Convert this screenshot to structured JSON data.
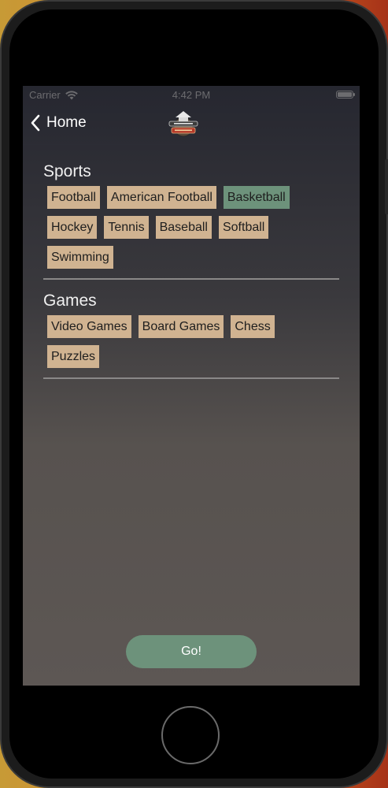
{
  "status_bar": {
    "carrier": "Carrier",
    "time": "4:42 PM",
    "wifi_icon": "wifi-icon",
    "battery_icon": "battery-icon",
    "battery_level": 1.0
  },
  "nav": {
    "back_label": "Home",
    "back_icon": "chevron-left-icon",
    "logo_icon": "village-sports-logo"
  },
  "sections": [
    {
      "title": "Sports",
      "tags": [
        {
          "label": "Football",
          "selected": false
        },
        {
          "label": "American Football",
          "selected": false
        },
        {
          "label": "Basketball",
          "selected": true
        },
        {
          "label": "Hockey",
          "selected": false
        },
        {
          "label": "Tennis",
          "selected": false
        },
        {
          "label": "Baseball",
          "selected": false
        },
        {
          "label": "Softball",
          "selected": false
        },
        {
          "label": "Swimming",
          "selected": false
        }
      ]
    },
    {
      "title": "Games",
      "tags": [
        {
          "label": "Video Games",
          "selected": false
        },
        {
          "label": "Board Games",
          "selected": false
        },
        {
          "label": "Chess",
          "selected": false
        },
        {
          "label": "Puzzles",
          "selected": false
        }
      ]
    }
  ],
  "go_button": {
    "label": "Go!"
  },
  "colors": {
    "tag": "#d0b391",
    "tag_selected": "#6d927b",
    "button": "#6d927b"
  }
}
